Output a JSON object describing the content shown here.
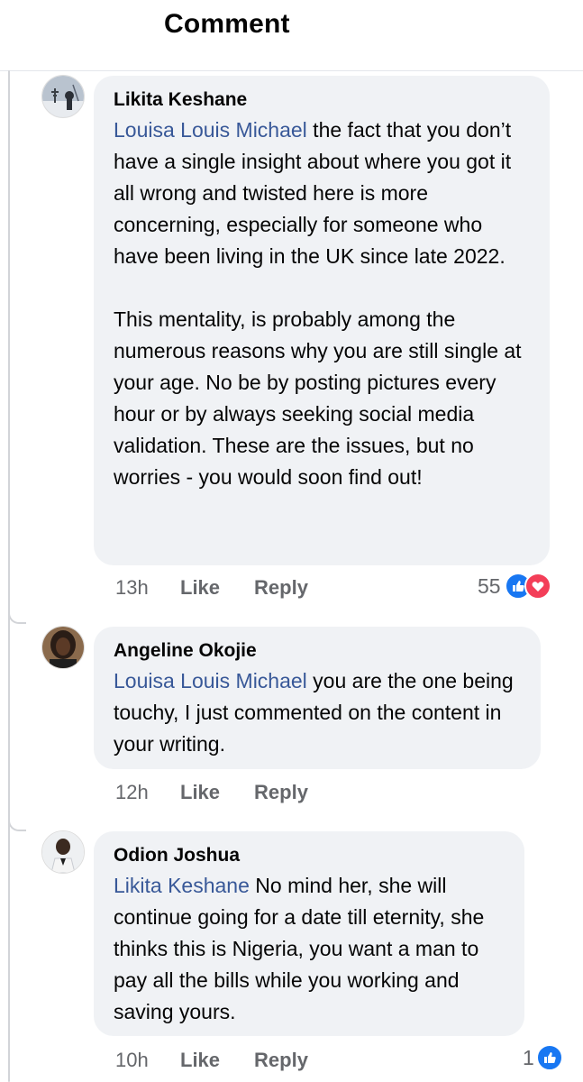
{
  "header": {
    "title": "Comment"
  },
  "comments": [
    {
      "author": "Likita Keshane",
      "mention": "Louisa Louis Michael",
      "text": " the fact that you don’t have a single insight about where you got it all wrong and twisted here is more concerning, especially for someone who have been living in the UK since late 2022.\n\nThis mentality, is probably among the numerous reasons why you are still single at your age. No be by posting pictures every hour or by always seeking social media validation. These are the issues, but no worries - you would soon find out!",
      "time": "13h",
      "like_label": "Like",
      "reply_label": "Reply",
      "reaction_count": "55",
      "reactions": [
        "like-icon",
        "love-icon"
      ]
    },
    {
      "author": "Angeline Okojie",
      "mention": "Louisa Louis Michael",
      "text": " you are the one being touchy, I just commented on the content in your writing.",
      "time": "12h",
      "like_label": "Like",
      "reply_label": "Reply"
    },
    {
      "author": "Odion Joshua",
      "mention": "Likita Keshane",
      "text": " No mind her, she will continue going for a date till eternity, she thinks this is Nigeria, you want a man to pay all the bills while you working and saving yours.",
      "time": "10h",
      "like_label": "Like",
      "reply_label": "Reply",
      "reaction_count": "1",
      "reactions": [
        "like-icon"
      ]
    }
  ],
  "colors": {
    "mention": "#385898",
    "bubble": "#f0f2f5",
    "like": "#1877f2",
    "love": "#f33e58",
    "meta": "#65676b"
  }
}
